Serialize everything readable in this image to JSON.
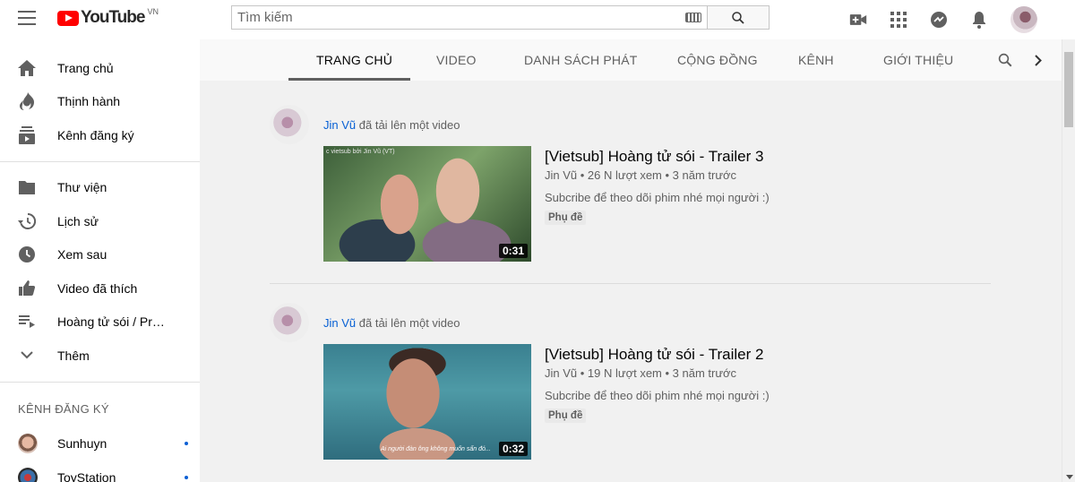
{
  "logo": {
    "text": "YouTube",
    "country": "VN"
  },
  "search": {
    "placeholder": "Tìm kiếm"
  },
  "sidebar": {
    "main": [
      {
        "label": "Trang chủ",
        "icon": "home-icon"
      },
      {
        "label": "Thịnh hành",
        "icon": "trending-icon"
      },
      {
        "label": "Kênh đăng ký",
        "icon": "subscriptions-icon"
      }
    ],
    "library": [
      {
        "label": "Thư viện",
        "icon": "library-icon"
      },
      {
        "label": "Lịch sử",
        "icon": "history-icon"
      },
      {
        "label": "Xem sau",
        "icon": "watch-later-icon"
      },
      {
        "label": "Video đã thích",
        "icon": "like-icon"
      },
      {
        "label": "Hoàng tử sói / Pri...",
        "icon": "playlist-icon"
      },
      {
        "label": "Thêm",
        "icon": "chevron-down-icon"
      }
    ],
    "subs_heading": "KÊNH ĐĂNG KÝ",
    "subscriptions": [
      {
        "label": "Sunhuyn"
      },
      {
        "label": "ToyStation"
      }
    ]
  },
  "tabs": [
    "TRANG CHỦ",
    "VIDEO",
    "DANH SÁCH PHÁT",
    "CỘNG ĐỒNG",
    "KÊNH",
    "GIỚI THIỆU"
  ],
  "posts": [
    {
      "channel": "Jin Vũ",
      "action": "đã tải lên một video",
      "title": "[Vietsub] Hoàng tử sói - Trailer 3",
      "meta": "Jin Vũ • 26 N lượt xem • 3 năm trước",
      "description": "Subcribe để theo dõi phim nhé mọi người :)",
      "badge": "Phụ đề",
      "duration": "0:31",
      "thumb_watermark": "c vietsub bởi Jin Vũ (VT)"
    },
    {
      "channel": "Jin Vũ",
      "action": "đã tải lên một video",
      "title": "[Vietsub] Hoàng tử sói - Trailer 2",
      "meta": "Jin Vũ • 19 N lượt xem • 3 năm trước",
      "description": "Subcribe để theo dõi phim nhé mọi người :)",
      "badge": "Phụ đề",
      "duration": "0:32",
      "thumb_subtitle": "Ai người đàn ông không muốn sẩn đó..."
    }
  ],
  "colors": {
    "brand": "#ff0000",
    "link": "#065fd4",
    "text": "#030303",
    "secondary": "#606060"
  }
}
